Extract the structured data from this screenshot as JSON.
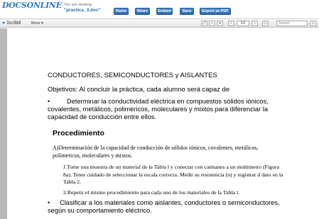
{
  "site": {
    "logo_line1": "DOCSONLINE",
    "logo_line2": "...",
    "viewing_label": "You are viewing:",
    "document_name": "\"practica_3.doc\""
  },
  "toolbar_buttons": [
    "Home",
    "Share",
    "Embed",
    "Save",
    "Export as PDF"
  ],
  "scribd_bar": {
    "brand": "Scribd",
    "more_label": "More",
    "page_indicator": "1/2",
    "search_placeholder": "Search"
  },
  "document": {
    "title": "CONDUCTORES, SEMICONDUCTORES y AISLANTES",
    "objective": "Objetivos: Al concluir la práctica, cada alumno será capaz de",
    "bullet_glyph": "•",
    "bullet1": "Determinar la conductividad eléctrica en compuestos sólidos iónicos, covalentes, metálicos, poliméricos, moleculares y mixtos para diferenciar la capacidad de conducción entre ellos.",
    "procedure_heading": "Procedimiento",
    "section_a": "A)Determinación de la capacidad de conducción de sólidos iónicos, covalentes, metálicos, polímericos, moleculares y mixtos.",
    "step1": "J.Tome una muestra de un material de la Tabla l y conectar con caimanes a un multímetro (Figura 8a). Tener cuidado de seleccionar la escala correcta. Medir su resistencia (n) y registrar d dato en la Tabla 2.",
    "step2": "2.Repetir el mismo procedimiento para cada uno de los materiales de la Tabla l.",
    "bullet2": "Clasificar a los materiales como aislantes, conductores o semiconductores, según su comportamiento eléctrico."
  }
}
